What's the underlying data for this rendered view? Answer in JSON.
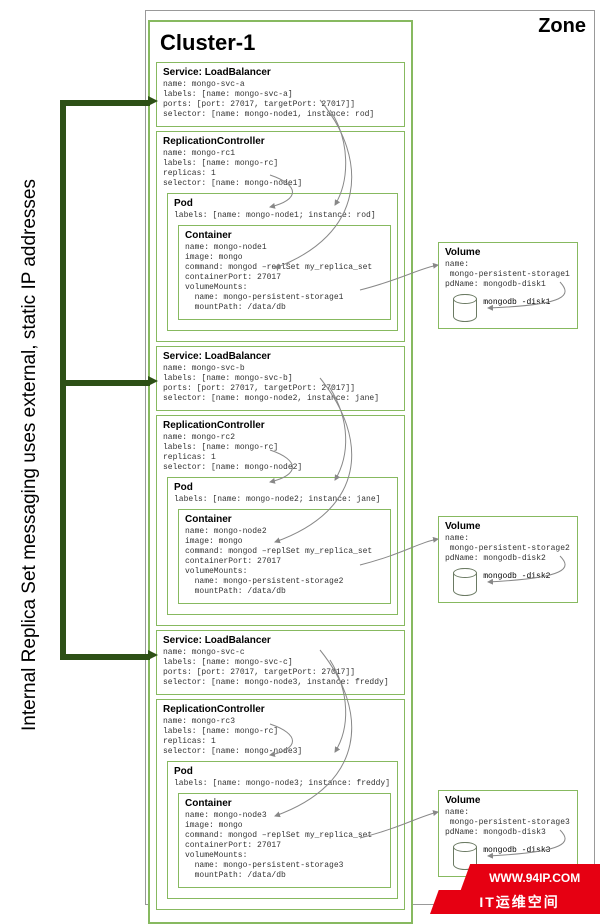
{
  "sidebar": {
    "text": "Internal Replica Set messaging uses\nexternal, static IP addresses"
  },
  "zone": {
    "label": "Zone"
  },
  "cluster": {
    "title": "Cluster-1"
  },
  "watermark": {
    "site": "WWW.94IP.COM",
    "tag": "IT运维空间"
  },
  "nodes": [
    {
      "service": {
        "title": "Service: LoadBalancer",
        "lines": "name: mongo-svc-a\nlabels: [name: mongo-svc-a]\nports: [port: 27017, targetPort: 27017]]\nselector: [name: mongo-node1, instance: rod]"
      },
      "rc": {
        "title": "ReplicationController",
        "lines": "name: mongo-rc1\nlabels: [name: mongo-rc]\nreplicas: 1\nselector: [name: mongo-node1]"
      },
      "pod": {
        "title": "Pod",
        "lines": "labels: [name: mongo-node1; instance: rod]"
      },
      "container": {
        "title": "Container",
        "lines": "name: mongo-node1\nimage: mongo\ncommand: mongod –replSet my_replica_set\ncontainerPort: 27017\nvolumeMounts:\n  name: mongo-persistent-storage1\n  mountPath: /data/db"
      },
      "volume": {
        "title": "Volume",
        "lines": "name:\n mongo-persistent-storage1\npdName: mongodb-disk1",
        "disk": "mongodb\n-disk1"
      }
    },
    {
      "service": {
        "title": "Service: LoadBalancer",
        "lines": "name: mongo-svc-b\nlabels: [name: mongo-svc-b]\nports: [port: 27017, targetPort: 27017]]\nselector: [name: mongo-node2, instance: jane]"
      },
      "rc": {
        "title": "ReplicationController",
        "lines": "name: mongo-rc2\nlabels: [name: mongo-rc]\nreplicas: 1\nselector: [name: mongo-node2]"
      },
      "pod": {
        "title": "Pod",
        "lines": "labels: [name: mongo-node2; instance: jane]"
      },
      "container": {
        "title": "Container",
        "lines": "name: mongo-node2\nimage: mongo\ncommand: mongod –replSet my_replica_set\ncontainerPort: 27017\nvolumeMounts:\n  name: mongo-persistent-storage2\n  mountPath: /data/db"
      },
      "volume": {
        "title": "Volume",
        "lines": "name:\n mongo-persistent-storage2\npdName: mongodb-disk2",
        "disk": "mongodb\n-disk2"
      }
    },
    {
      "service": {
        "title": "Service: LoadBalancer",
        "lines": "name: mongo-svc-c\nlabels: [name: mongo-svc-c]\nports: [port: 27017, targetPort: 27017]]\nselector: [name: mongo-node3, instance: freddy]"
      },
      "rc": {
        "title": "ReplicationController",
        "lines": "name: mongo-rc3\nlabels: [name: mongo-rc]\nreplicas: 1\nselector: [name: mongo-node3]"
      },
      "pod": {
        "title": "Pod",
        "lines": "labels: [name: mongo-node3; instance: freddy]"
      },
      "container": {
        "title": "Container",
        "lines": "name: mongo-node3\nimage: mongo\ncommand: mongod –replSet my_replica_set\ncontainerPort: 27017\nvolumeMounts:\n  name: mongo-persistent-storage3\n  mountPath: /data/db"
      },
      "volume": {
        "title": "Volume",
        "lines": "name:\n mongo-persistent-storage3\npdName: mongodb-disk3",
        "disk": "mongodb\n-disk3"
      }
    }
  ]
}
